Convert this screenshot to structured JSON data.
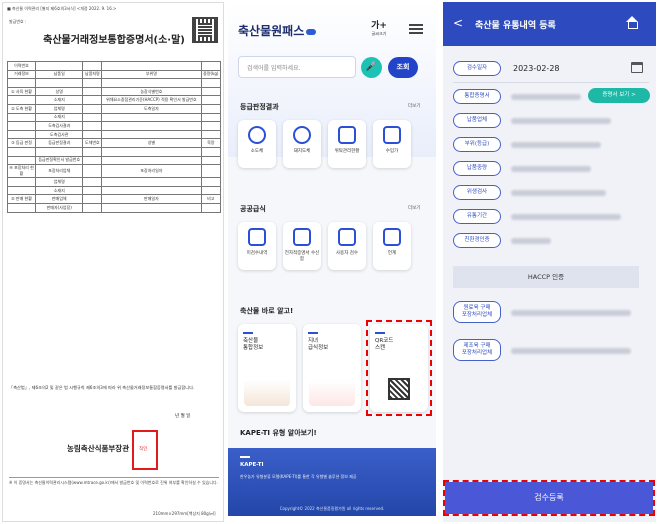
{
  "document": {
    "top_line": "■ 축산물 이력관리 [별지 제6호의3서식] <개정 2022. 9. 16.>",
    "issue_no": "발급번호 :",
    "title": "축산물거래정보통합증명서(소·말)",
    "table_rows": [
      [
        "이력번호",
        "",
        "",
        "",
        ""
      ],
      [
        "거래정보",
        "납품일",
        "납품처명",
        "부위명",
        "중량(kg)"
      ],
      [
        "",
        "",
        "",
        "",
        ""
      ],
      [
        "① 사육 현황",
        "성명",
        "",
        "농장식별번호",
        ""
      ],
      [
        "",
        "소재지",
        "",
        "위해요소중점관리기준(HACCP) 적용 확인서 발급번호",
        ""
      ],
      [
        "② 도축 현황",
        "업체명",
        "",
        "도축일자",
        ""
      ],
      [
        "",
        "소재지",
        "",
        "",
        ""
      ],
      [
        "",
        "도축검사결과",
        "",
        "",
        ""
      ],
      [
        "",
        "도축검사관",
        "",
        "",
        ""
      ],
      [
        "③ 등급 판정",
        "등급판정결과",
        "도체번호",
        "성별",
        "육량"
      ],
      [
        "",
        "",
        "",
        "",
        ""
      ],
      [
        "",
        "등급판정확인서 발급번호",
        "",
        "",
        ""
      ],
      [
        "④ 포장처리 현황",
        "포장처리업체",
        "",
        "포장처리일자",
        ""
      ],
      [
        "",
        "업체명",
        "",
        "",
        ""
      ],
      [
        "",
        "소재지",
        "",
        "",
        ""
      ],
      [
        "⑤ 판매 현황",
        "판매업체",
        "",
        "판매일자",
        "비고"
      ],
      [
        "",
        "판매자(사업장)",
        "",
        "",
        ""
      ]
    ],
    "footnote_top": "「축산법」, 제6조의2 및 같은 법 시행규칙 제6조의3에 따라 위 축산물거래정보통합증명서를 발급합니다.",
    "date_line": "년   월   일",
    "minister": "농림축산식품부장관",
    "stamp_label": "직인",
    "footnote_bottom": "※ 이 증명서는 축산물이력관리시스템(www.mtrace.go.kr)에서 발급번호 및 이력번호로 진위 여부를 확인하실 수 있습니다.",
    "paper_size": "210mm×297mm[백상지 80g/㎡]"
  },
  "app": {
    "brand": "축산물원패스",
    "font_label_big": "가+",
    "font_label_small": "글씨크기",
    "search_placeholder": "검색어를 입력하세요.",
    "search_button": "조회",
    "section1_title": "등급판정결과",
    "section1_more": "더보기",
    "section1_items": [
      "소도체",
      "돼지도체",
      "위탁관리현황",
      "수입가"
    ],
    "section2_title": "공공급식",
    "section2_more": "더보기",
    "section2_items": [
      "미검수내역",
      "전자적증명서 수신함",
      "사용자 검수",
      "언계"
    ],
    "section3_title": "축산물 바로 알고!",
    "section3_items": [
      "축산물\n통합정보",
      "지녀\n급식정보",
      "QR코드\n스캔"
    ],
    "section4_title": "KAPE-TI 유형 알아보기!",
    "banner_title": "KAPE-TI",
    "banner_text": "한우농가 유형분류 모델(KAPE-TI)를 통한 각 유형별 솔루션 정보 제공",
    "copyright": "Copyright© 2022 축산물품질평가원 all rights reserved."
  },
  "form": {
    "title": "축산물 유통내역 등록",
    "fields": [
      {
        "label": "검수일자",
        "value": "2023-02-28"
      },
      {
        "label": "통합증명서",
        "value": ""
      },
      {
        "label": "납품업체",
        "value": ""
      },
      {
        "label": "부위(등급)",
        "value": ""
      },
      {
        "label": "납품중량",
        "value": ""
      },
      {
        "label": "위생검사",
        "value": ""
      },
      {
        "label": "유통기간",
        "value": ""
      },
      {
        "label": "친환경인증",
        "value": ""
      }
    ],
    "cert_button": "증명서 보기 >",
    "haccp_header": "HACCP 인증",
    "haccp_fields": [
      "원료육 구매\n포장처리업체",
      "제조육 구매\n포장처리업체"
    ],
    "submit": "검수등록"
  },
  "colors": {
    "accent": "#2d4bbf",
    "teal": "#1eb9a6",
    "highlight": "#e00000"
  }
}
